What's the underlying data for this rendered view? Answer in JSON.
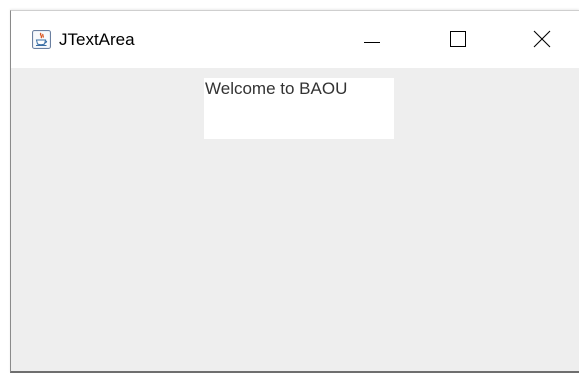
{
  "window": {
    "title": "JTextArea",
    "icon": "java-coffee-cup-icon",
    "controls": {
      "minimize_icon": "minimize-icon",
      "maximize_icon": "maximize-icon",
      "close_icon": "close-icon"
    }
  },
  "text_area": {
    "text": "Welcome to BAOU"
  },
  "colors": {
    "titlebar_bg": "#ffffff",
    "content_bg": "#eeeeee",
    "text_area_bg": "#ffffff",
    "text_color": "#333333"
  }
}
